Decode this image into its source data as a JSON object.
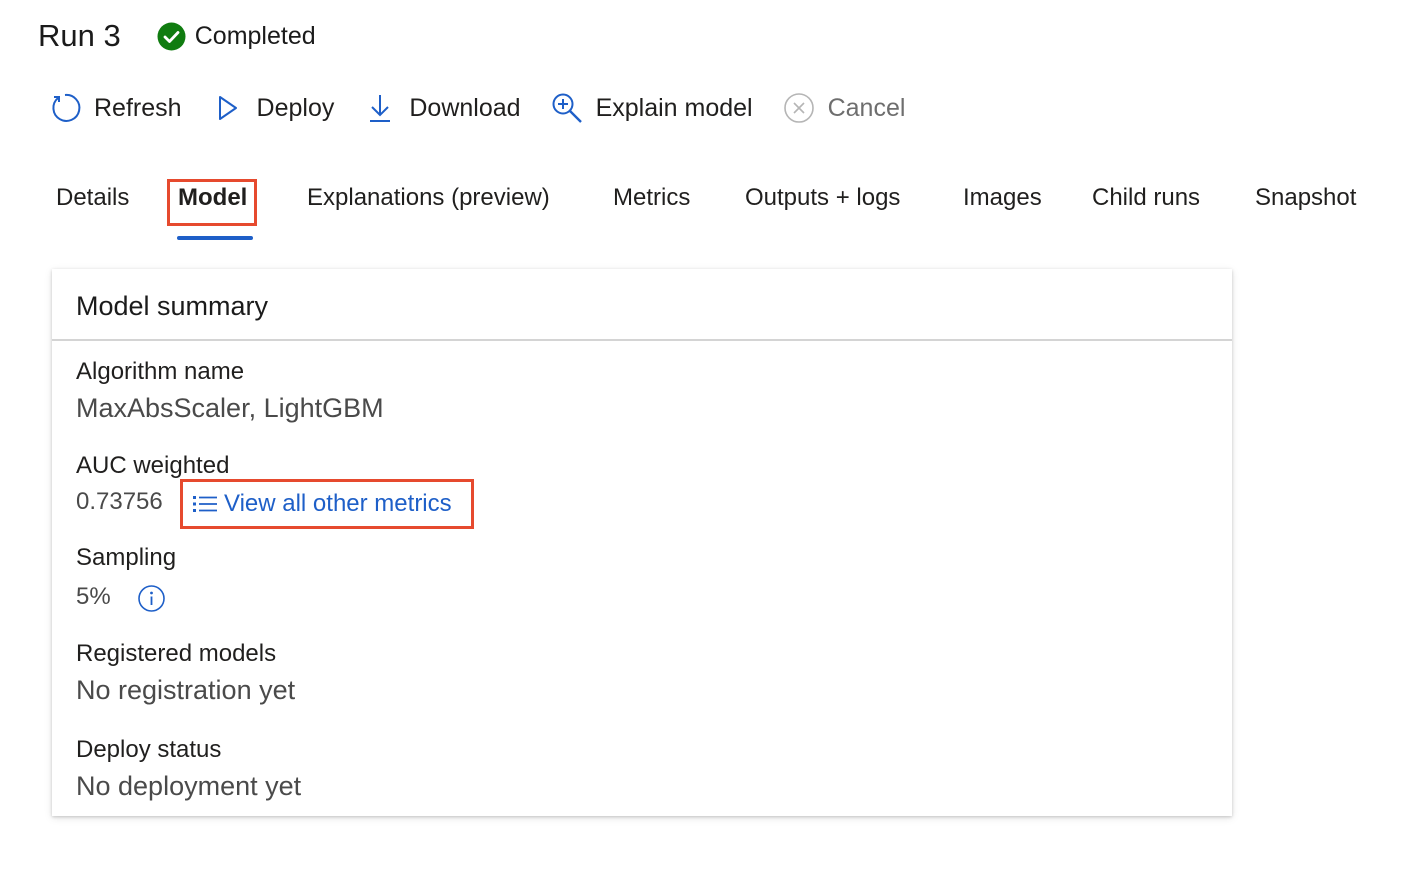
{
  "header": {
    "run_title": "Run 3",
    "status_text": "Completed",
    "status_color": "#107c10"
  },
  "toolbar": {
    "refresh_label": "Refresh",
    "deploy_label": "Deploy",
    "download_label": "Download",
    "explain_label": "Explain model",
    "cancel_label": "Cancel"
  },
  "tabs": {
    "details": "Details",
    "model": "Model",
    "explanations": "Explanations (preview)",
    "metrics": "Metrics",
    "outputs_logs": "Outputs + logs",
    "images": "Images",
    "child_runs": "Child runs",
    "snapshot": "Snapshot",
    "active": "Model"
  },
  "model_summary": {
    "title": "Model summary",
    "algorithm_label": "Algorithm name",
    "algorithm_value": "MaxAbsScaler, LightGBM",
    "auc_label": "AUC weighted",
    "auc_value": "0.73756",
    "view_metrics_link": "View all other metrics",
    "sampling_label": "Sampling",
    "sampling_value": "5%",
    "registered_label": "Registered models",
    "registered_value": "No registration yet",
    "deploy_status_label": "Deploy status",
    "deploy_status_value": "No deployment yet"
  },
  "colors": {
    "accent": "#1e5fc8",
    "highlight": "#e64a2e"
  },
  "icons": {
    "status": "check-circle-icon",
    "refresh": "refresh-icon",
    "deploy": "play-icon",
    "download": "download-icon",
    "explain": "zoom-in-icon",
    "cancel": "cancel-circle-icon",
    "metrics_link": "list-icon",
    "sampling_info": "info-icon"
  }
}
